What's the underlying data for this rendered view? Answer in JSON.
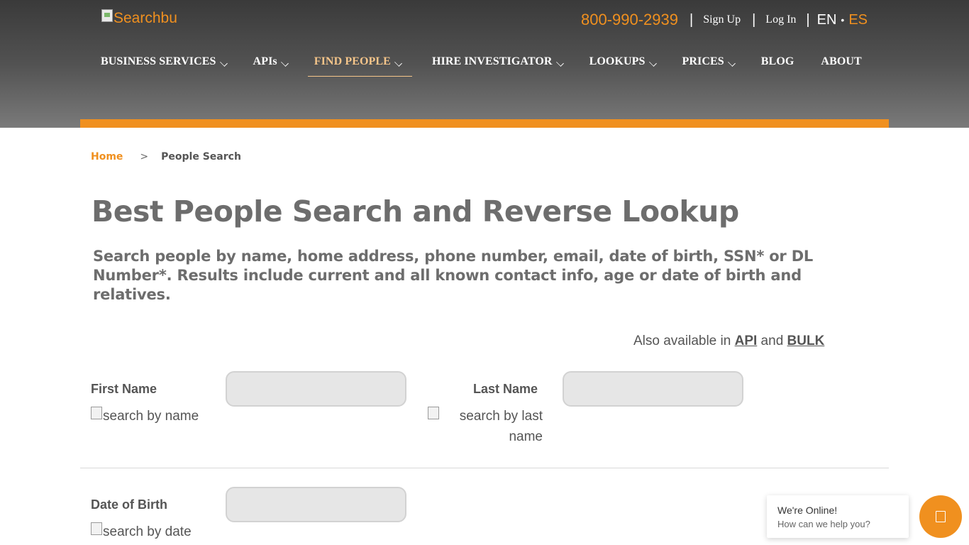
{
  "header": {
    "logo_alt": "Searchbu",
    "phone": "800-990-2939",
    "sep1": "|",
    "signup": "Sign Up",
    "sep2": "|",
    "login": "Log In",
    "sep3": "|",
    "lang_en": "EN",
    "lang_dot": "•",
    "lang_es": "ES",
    "accent_color": "#f0901f"
  },
  "nav": {
    "items": [
      {
        "label": "BUSINESS SERVICES"
      },
      {
        "label": "APIs"
      },
      {
        "label": "FIND PEOPLE"
      },
      {
        "label": "HIRE INVESTIGATOR"
      },
      {
        "label": "LOOKUPS"
      },
      {
        "label": "PRICES"
      },
      {
        "label": "BLOG"
      },
      {
        "label": "ABOUT"
      }
    ],
    "active": "FIND PEOPLE"
  },
  "breadcrumb": {
    "home": "Home",
    "sep": ">",
    "current": "People Search"
  },
  "main": {
    "title": "Best People Search and Reverse Lookup",
    "subtitle": "Search people by name, home address, phone number, email, date of birth, SSN* or DL Number*. Results include current and all known contact info, age or date of birth and relatives.",
    "also_prefix": "Also available in ",
    "also_api": "API",
    "also_and": " and ",
    "also_bulk": "BULK"
  },
  "form": {
    "first_name_label": "First Name",
    "first_name_value": "",
    "first_name_img_alt": "search by name",
    "last_name_label": "Last Name",
    "last_name_value": "",
    "last_name_img_alt": "search by last name",
    "dob_label": "Date of Birth",
    "dob_value": "",
    "dob_img_alt": "search by date"
  },
  "chat": {
    "title": "We're Online!",
    "subtitle": "How can we help you?"
  }
}
